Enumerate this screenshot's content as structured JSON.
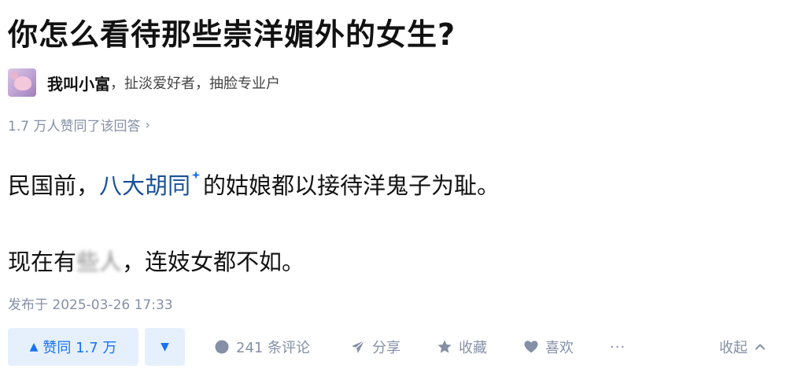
{
  "question": {
    "title": "你怎么看待那些崇洋媚外的女生?"
  },
  "author": {
    "name": "我叫小富",
    "bio": "，扯淡爱好者，抽脸专业户"
  },
  "answer_meta": {
    "upvote_summary": "1.7 万人赞同了该回答",
    "chevron": "›"
  },
  "content": {
    "p1_prefix": "民国前，",
    "p1_link": "八大胡同",
    "p1_suffix": "的姑娘都以接待洋鬼子为耻。",
    "p2_prefix": "现在有",
    "p2_blurred": "些人",
    "p2_suffix": "，连妓女都不如。"
  },
  "publish_time": "发布于 2025-03-26 17:33",
  "actions": {
    "vote_up_icon": "▲",
    "vote_up_label": "赞同 1.7 万",
    "vote_down_icon": "▼",
    "comment_label": "241 条评论",
    "share_label": "分享",
    "collect_label": "收藏",
    "like_label": "喜欢",
    "more_label": "···",
    "collapse_label": "收起"
  },
  "colors": {
    "link": "#175199",
    "brand_blue": "#1772f6",
    "vote_bg": "#e6f0fd",
    "meta_gray": "#8590a6"
  },
  "icons": {
    "topic_link": "sparkle-icon",
    "comment": "comment-bubble-icon",
    "share": "paper-plane-icon",
    "collect": "star-icon",
    "like": "heart-icon",
    "collapse": "chevron-up-icon"
  }
}
